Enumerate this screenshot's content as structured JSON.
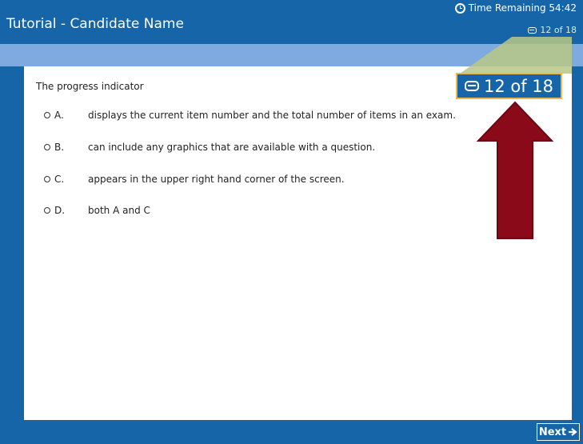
{
  "header": {
    "title": "Tutorial - Candidate Name",
    "time_remaining": "Time Remaining 54:42",
    "progress_small": "12 of 18"
  },
  "question": {
    "stem": "The progress indicator",
    "options": [
      {
        "letter": "A.",
        "text": "displays the current item number and the total number of items in an exam."
      },
      {
        "letter": "B.",
        "text": "can include any graphics that are available with a question."
      },
      {
        "letter": "C.",
        "text": "appears in the upper right hand corner of the screen."
      },
      {
        "letter": "D.",
        "text": "both A and C"
      }
    ]
  },
  "progress_indicator": {
    "text": "12 of 18",
    "current": 12,
    "total": 18
  },
  "footer": {
    "next_label": "Next"
  },
  "colors": {
    "header_blue": "#1565a8",
    "strip_blue": "#7eaadf",
    "highlight_border": "#e8b84a",
    "callout_green": "#b7c886",
    "arrow_red": "#8b0a1a"
  },
  "icons": [
    "clock-icon",
    "progress-icon",
    "arrow-up-icon",
    "arrow-right-icon"
  ]
}
